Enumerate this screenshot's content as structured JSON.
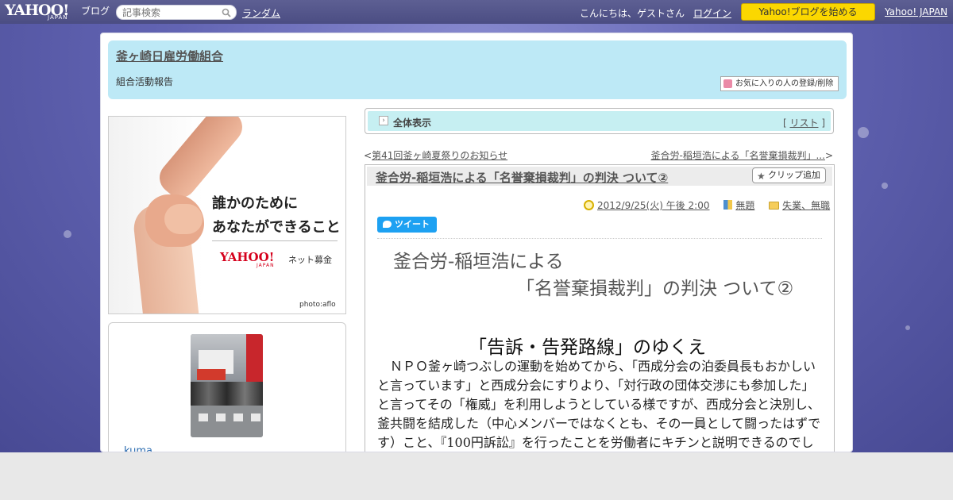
{
  "topbar": {
    "logo_text": "YAHOO!",
    "logo_japan": "JAPAN",
    "logo_blog": "ブログ",
    "search_placeholder": "記事検索",
    "random_link": "ランダム",
    "greeting": "こんにちは、ゲストさん",
    "login_link": "ログイン",
    "start_button": "Yahoo!ブログを始める",
    "yahoo_japan_link": "Yahoo! JAPAN"
  },
  "header": {
    "blog_title": "釜ヶ崎日雇労働組合",
    "blog_subtitle": "組合活動報告",
    "favorite_button": "お気に入りの人の登録/削除"
  },
  "sidebar": {
    "ad": {
      "line1": "誰かのために",
      "line2": "あなたができること",
      "logo": "YAHOO!",
      "logo_japan": "JAPAN",
      "service": "ネット募金",
      "credit": "photo:aflo"
    },
    "profile": {
      "username": "kuma"
    }
  },
  "main": {
    "all_view_label": "全体表示",
    "list_bracket_open": "[ ",
    "list_link": "リスト",
    "list_bracket_close": " ]",
    "prev_arrow": "<",
    "prev_link": "第41回釜ヶ崎夏祭りのお知らせ",
    "next_link": "釜合労-稲垣浩による「名誉棄損裁判」...",
    "next_arrow": ">",
    "article": {
      "title": "釜合労-稲垣浩による「名誉棄損裁判」の判決 ついて②",
      "clip_button": "クリップ追加",
      "date": "2012/9/25(火) 午後 2:00",
      "theme": "無題",
      "category": "失業、無職",
      "tweet_button": "ツイート",
      "heading_line1": "釜合労-稲垣浩による",
      "heading_line2": "「名誉棄損裁判」の判決 ついて②",
      "subheading": "「告訴・告発路線」のゆくえ",
      "body": "　ＮＰＯ釜ヶ崎つぶしの運動を始めてから、「西成分会の泊委員長もおかしいと言っています」と西成分会にすりより、「対行政の団体交渉にも参加した」と言ってその「権威」を利用しようとしている様ですが、西成分会と決別し、釜共闘を結成した（中心メンバーではなくとも、その一員として闘ったはずです）こと、『100円訴訟』を行ったことを労働者にキチンと説明できるのでしょうか。"
    }
  },
  "colors": {
    "topbar": "#4b4d83",
    "header_bg": "#bde9f6",
    "start_button": "#fbd700",
    "tweet": "#1da1f2",
    "all_view_bg": "#c6eff2"
  }
}
